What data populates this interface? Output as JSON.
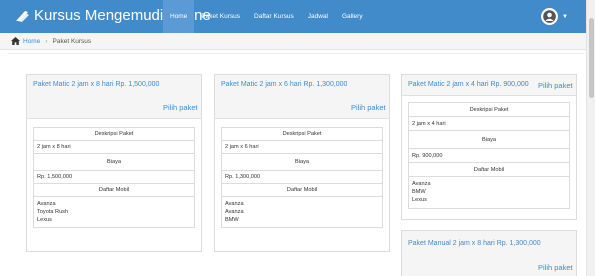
{
  "navbar": {
    "brand": "Kursus Mengemudi Online",
    "links": [
      "Home",
      "Paket Kursus",
      "Daftar Kursus",
      "Jadwal",
      "Gallery"
    ],
    "icons": {
      "brand": "car-icon",
      "avatar": "user-avatar-icon",
      "caret": "caret-down-icon"
    }
  },
  "breadcrumb": {
    "home": "Home",
    "separator": "›",
    "current": "Paket Kursus"
  },
  "packages": [
    {
      "title": "Paket Matic 2 jam x 8 hari Rp. 1,500,000",
      "pilih": "Pilih paket",
      "desc_header": "Deskripsi Paket",
      "desc": "2 jam x 8 hari",
      "price_header": "Biaya",
      "price": "Rp. 1,500,000",
      "cars_header": "Daftar Mobil",
      "cars": [
        "Avanza",
        "Toyota Rush",
        "Lexus"
      ]
    },
    {
      "title": "Paket Matic 2 jam x 6 hari Rp. 1,300,000",
      "pilih": "Pilih paket",
      "desc_header": "Deskripsi Paket",
      "desc": "2 jam x 6 hari",
      "price_header": "Biaya",
      "price": "Rp. 1,300,000",
      "cars_header": "Daftar Mobil",
      "cars": [
        "Avanza",
        "Avanza",
        "BMW"
      ]
    },
    {
      "title": "Paket Matic 2 jam x 4 hari Rp. 900,000",
      "pilih": "Pilih paket",
      "desc_header": "Deskripsi Paket",
      "desc": "2 jam x 4 hari",
      "price_header": "Biaya",
      "price": "Rp. 900,000",
      "cars_header": "Daftar Mobil",
      "cars": [
        "Avanza",
        "BMW",
        "Lexus"
      ]
    },
    {
      "title": "Paket Manual 2 jam x 8 hari Rp. 1,300,000",
      "pilih": "Pilih paket"
    }
  ],
  "colors": {
    "navbar": "#428bca",
    "link": "#428bca",
    "panel_heading": "#f5f5f5"
  }
}
